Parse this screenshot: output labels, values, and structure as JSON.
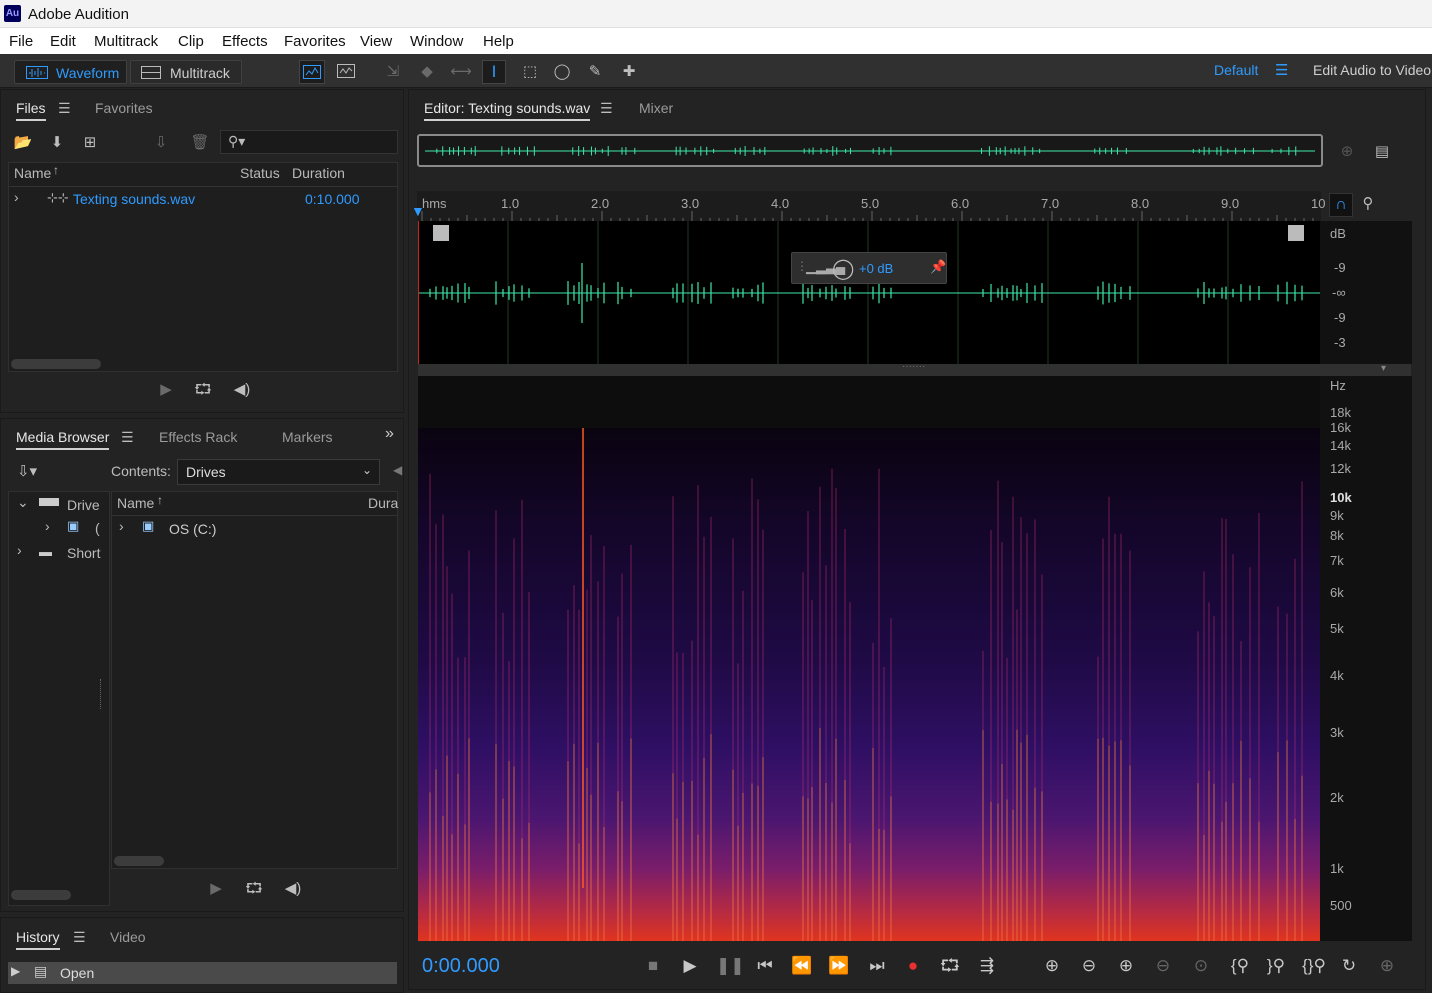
{
  "app": {
    "title": "Adobe Audition",
    "icon": "Au"
  },
  "menu": [
    "File",
    "Edit",
    "Multitrack",
    "Clip",
    "Effects",
    "Favorites",
    "View",
    "Window",
    "Help"
  ],
  "toolbar": {
    "waveform_label": "Waveform",
    "multitrack_label": "Multitrack",
    "workspace": "Default",
    "workspace_alt": "Edit Audio to Video"
  },
  "files_panel": {
    "tabs": [
      "Files",
      "Favorites"
    ],
    "columns": [
      "Name",
      "Status",
      "Duration"
    ],
    "items": [
      {
        "name": "Texting sounds.wav",
        "duration": "0:10.000"
      }
    ]
  },
  "media_panel": {
    "tabs": [
      "Media Browser",
      "Effects Rack",
      "Markers"
    ],
    "contents_label": "Contents:",
    "contents_value": "Drives",
    "tree": [
      "Drive",
      "(",
      "Short"
    ],
    "columns": [
      "Name",
      "Dura"
    ],
    "items": [
      "OS (C:)"
    ]
  },
  "history_panel": {
    "tabs": [
      "History",
      "Video"
    ],
    "items": [
      "Open"
    ]
  },
  "editor": {
    "tabs": [
      "Editor: Texting sounds.wav",
      "Mixer"
    ],
    "ruler_unit": "hms",
    "ruler_ticks": [
      "1.0",
      "2.0",
      "3.0",
      "4.0",
      "5.0",
      "6.0",
      "7.0",
      "8.0",
      "9.0",
      "10"
    ],
    "db_labels": [
      "dB",
      "-9",
      "-∞",
      "-9",
      "-3"
    ],
    "hz_labels": [
      "Hz",
      "18k",
      "16k",
      "14k",
      "12k",
      "10k",
      "9k",
      "8k",
      "7k",
      "6k",
      "5k",
      "4k",
      "3k",
      "2k",
      "1k",
      "500"
    ],
    "hud_gain": "+0 dB",
    "time": "0:00.000"
  },
  "colors": {
    "accent": "#2f9bff",
    "waveform": "#3ee8a8"
  }
}
